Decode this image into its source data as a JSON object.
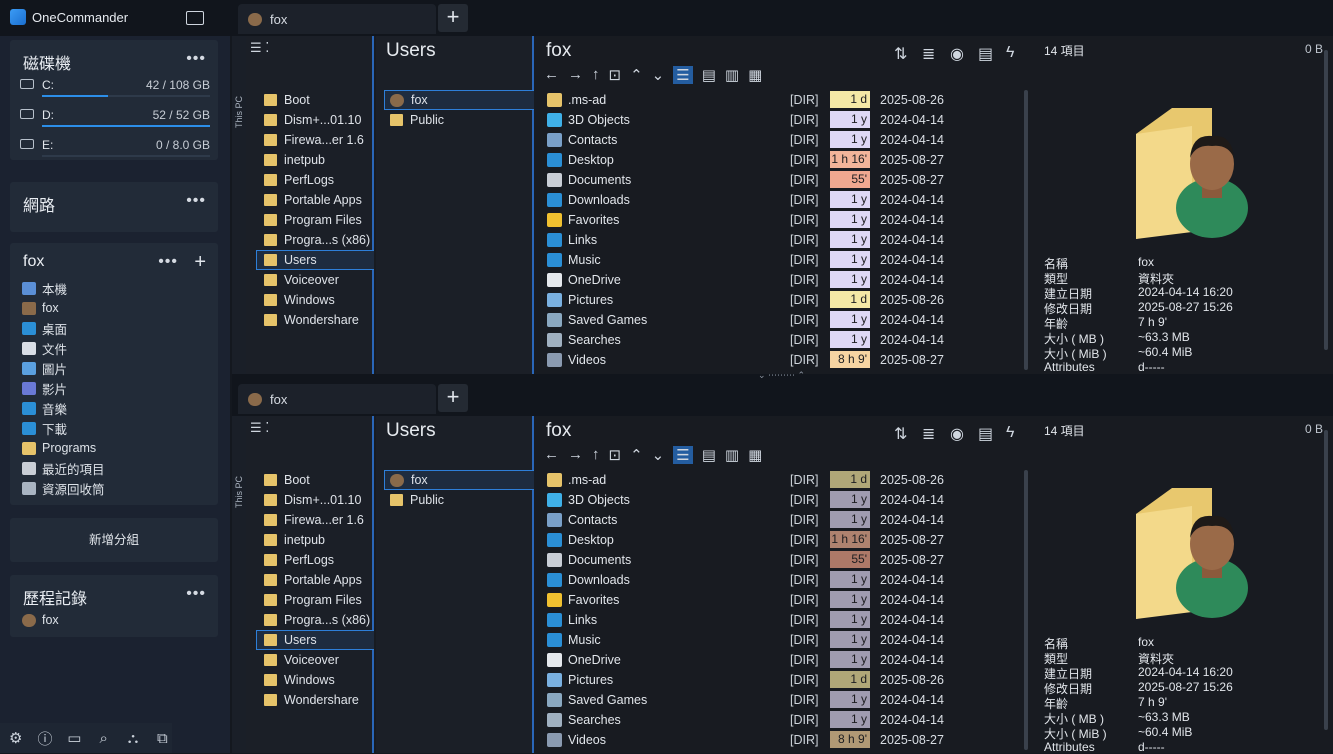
{
  "app": {
    "title": "OneCommander"
  },
  "drives": {
    "title": "磁碟機",
    "items": [
      {
        "label": "C:",
        "value": "42 / 108 GB",
        "usage": 0.39
      },
      {
        "label": "D:",
        "value": "52 / 52 GB",
        "usage": 1.0
      },
      {
        "label": "E:",
        "value": "0 / 8.0 GB",
        "usage": 0.0
      }
    ]
  },
  "network": {
    "title": "網路"
  },
  "favorites": {
    "title": "fox",
    "items": [
      "本機",
      "fox",
      "桌面",
      "文件",
      "圖片",
      "影片",
      "音樂",
      "下載",
      "Programs",
      "最近的項目",
      "資源回收筒"
    ]
  },
  "add_group": "新增分組",
  "history": {
    "title": "歷程記錄",
    "items": [
      "fox"
    ]
  },
  "pane": {
    "tab_label": "fox",
    "this_pc": "This PC",
    "col1_items": [
      "Boot",
      "Dism+...01.10",
      "Firewa...er 1.6",
      "inetpub",
      "PerfLogs",
      "Portable Apps",
      "Program Files",
      "Progra...s (x86)",
      "Users",
      "Voiceover",
      "Windows",
      "Wondershare"
    ],
    "col2_title": "Users",
    "col2_items": [
      "fox",
      "Public"
    ],
    "col3_title": "fox",
    "files": [
      {
        "name": ".ms-ad",
        "type": "[DIR]",
        "age": "1 d",
        "date": "2025-08-26",
        "color": "#f4e8a6"
      },
      {
        "name": "3D Objects",
        "type": "[DIR]",
        "age": "1 y",
        "date": "2024-04-14",
        "color": "#ded8f5"
      },
      {
        "name": "Contacts",
        "type": "[DIR]",
        "age": "1 y",
        "date": "2024-04-14",
        "color": "#ded8f5"
      },
      {
        "name": "Desktop",
        "type": "[DIR]",
        "age": "1 h 16'",
        "date": "2025-08-27",
        "color": "#f2b49a"
      },
      {
        "name": "Documents",
        "type": "[DIR]",
        "age": "55'",
        "date": "2025-08-27",
        "color": "#f0a890"
      },
      {
        "name": "Downloads",
        "type": "[DIR]",
        "age": "1 y",
        "date": "2024-04-14",
        "color": "#ded8f5"
      },
      {
        "name": "Favorites",
        "type": "[DIR]",
        "age": "1 y",
        "date": "2024-04-14",
        "color": "#ded8f5"
      },
      {
        "name": "Links",
        "type": "[DIR]",
        "age": "1 y",
        "date": "2024-04-14",
        "color": "#ded8f5"
      },
      {
        "name": "Music",
        "type": "[DIR]",
        "age": "1 y",
        "date": "2024-04-14",
        "color": "#ded8f5"
      },
      {
        "name": "OneDrive",
        "type": "[DIR]",
        "age": "1 y",
        "date": "2024-04-14",
        "color": "#ded8f5"
      },
      {
        "name": "Pictures",
        "type": "[DIR]",
        "age": "1 d",
        "date": "2025-08-26",
        "color": "#f4e8a6"
      },
      {
        "name": "Saved Games",
        "type": "[DIR]",
        "age": "1 y",
        "date": "2024-04-14",
        "color": "#ded8f5"
      },
      {
        "name": "Searches",
        "type": "[DIR]",
        "age": "1 y",
        "date": "2024-04-14",
        "color": "#ded8f5"
      },
      {
        "name": "Videos",
        "type": "[DIR]",
        "age": "8 h 9'",
        "date": "2025-08-27",
        "color": "#f6d4a2"
      }
    ],
    "preview": {
      "count": "14 項目",
      "size": "0 B",
      "props": [
        [
          "名稱",
          "fox"
        ],
        [
          "類型",
          "資料夾"
        ],
        [
          "建立日期",
          "2024-04-14  16:20"
        ],
        [
          "修改日期",
          "2025-08-27  15:26"
        ],
        [
          "年齡",
          "7 h 9'"
        ],
        [
          "大小 ( MB )",
          "~63.3 MB"
        ],
        [
          "大小 ( MiB )",
          "~60.4 MiB"
        ],
        [
          "Attributes",
          "d-----"
        ]
      ]
    }
  },
  "pane2": {
    "preview": {
      "count": "14 項目",
      "size": "0 B"
    }
  }
}
